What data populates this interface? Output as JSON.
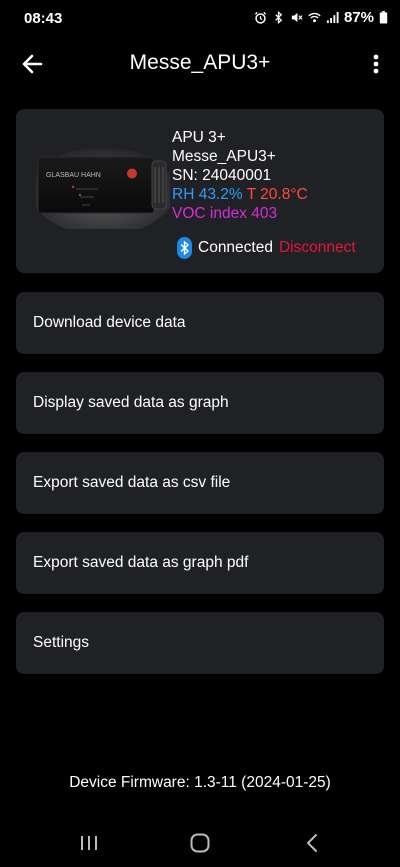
{
  "status": {
    "time": "08:43",
    "battery": "87%",
    "icons": [
      "alarm-icon",
      "bluetooth-icon",
      "mute-icon",
      "wifi-icon",
      "signal-icon",
      "battery-icon"
    ]
  },
  "header": {
    "title": "Messe_APU3+"
  },
  "device": {
    "model": "APU 3+",
    "name": "Messe_APU3+",
    "serial": "SN: 24040001",
    "rh_label": "RH 43.2%",
    "temp_label": "T 20.8°C",
    "voc_label": "VOC index 403",
    "connection_status": "Connected",
    "disconnect_label": "Disconnect",
    "device_brand": "GLASBAU HAHN"
  },
  "menu": [
    {
      "label": "Download device data"
    },
    {
      "label": "Display saved data as graph"
    },
    {
      "label": "Export saved data as csv file"
    },
    {
      "label": "Export saved data as graph pdf"
    },
    {
      "label": "Settings"
    }
  ],
  "footer": {
    "firmware": "Device Firmware: 1.3-11 (2024-01-25)"
  },
  "colors": {
    "background": "#000000",
    "card": "#202124",
    "rh": "#2f9bff",
    "temp": "#ff4a3d",
    "voc": "#d42fd6",
    "disconnect": "#e3163a",
    "bluetooth": "#1e88e5"
  }
}
